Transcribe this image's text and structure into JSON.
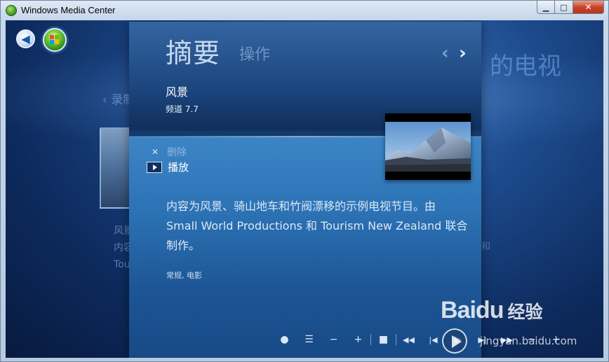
{
  "window": {
    "title": "Windows Media Center",
    "minimize_label": "▁",
    "maximize_label": "□",
    "close_label": "✕"
  },
  "background": {
    "title_right": "的电视",
    "crumb": "‹ 录制",
    "left_line1": "风景",
    "left_line2": "内容",
    "left_line3": "Tou",
    "right_mark": "和"
  },
  "panel": {
    "tabs": [
      {
        "label": "摘要",
        "active": true
      },
      {
        "label": "操作",
        "active": false
      }
    ],
    "nav_prev": "‹",
    "nav_next": "›",
    "show_title": "风景",
    "channel": "频道 7.7",
    "actions": [
      {
        "label": "删除",
        "icon": "close-icon"
      },
      {
        "label": "播放",
        "icon": "play-icon"
      }
    ],
    "description": "内容为风景、骑山地车和竹阀漂移的示例电视节目。由 Small World Productions 和 Tourism New Zealand 联合制作。",
    "genres": "常规, 电影"
  },
  "transport": {
    "buttons": [
      {
        "name": "record-button",
        "icon": "record-icon",
        "symbol": "●"
      },
      {
        "name": "guide-button",
        "icon": "list-icon",
        "symbol": "☰"
      },
      {
        "name": "channel-down-button",
        "icon": "minus-icon",
        "symbol": "−"
      },
      {
        "name": "channel-up-button",
        "icon": "plus-icon",
        "symbol": "+"
      },
      {
        "name": "stop-button",
        "icon": "stop-icon",
        "symbol": "■"
      },
      {
        "name": "rewind-button",
        "icon": "rewind-icon",
        "symbol": "◀◀"
      },
      {
        "name": "skip-back-button",
        "icon": "skip-back-icon",
        "symbol": "|◀"
      },
      {
        "name": "play-button",
        "icon": "play-icon",
        "symbol": "▶"
      },
      {
        "name": "skip-forward-button",
        "icon": "skip-forward-icon",
        "symbol": "▶|"
      },
      {
        "name": "fast-forward-button",
        "icon": "fast-forward-icon",
        "symbol": "▶▶"
      },
      {
        "name": "volume-down-button",
        "icon": "minus-icon",
        "symbol": "−"
      },
      {
        "name": "volume-up-button",
        "icon": "plus-icon",
        "symbol": "+"
      }
    ]
  },
  "watermark": {
    "brand": "Bai",
    "brand_suffix": "du",
    "product": "经验",
    "url": "jingyan.baidu.com"
  },
  "colors": {
    "panel_top": "#2b5b97",
    "panel_body": "#2d74b6",
    "background_deep": "#0d2a5d",
    "accent_text": "#dbe8f6"
  }
}
